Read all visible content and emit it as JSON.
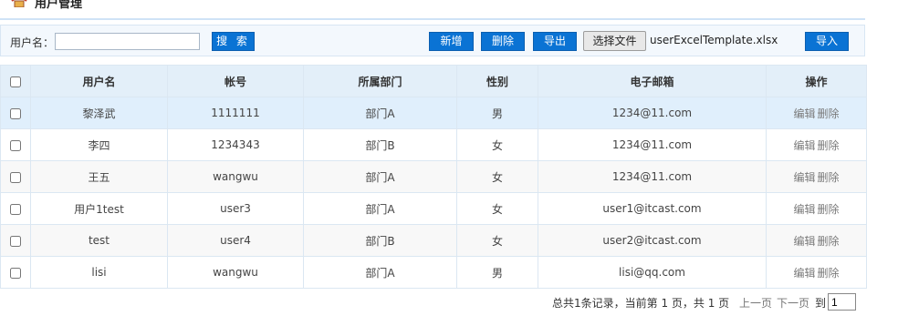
{
  "page": {
    "title": "用户管理",
    "icon": "home-icon"
  },
  "search": {
    "label": "用户名：",
    "value": "",
    "button_label": "搜 索"
  },
  "toolbar": {
    "add_label": "新增",
    "delete_label": "删除",
    "export_label": "导出",
    "choose_file_label": "选择文件",
    "file_name": "userExcelTemplate.xlsx",
    "import_label": "导入"
  },
  "table": {
    "columns": [
      "用户名",
      "帐号",
      "所属部门",
      "性别",
      "电子邮箱",
      "操作"
    ],
    "rows": [
      {
        "name": "黎泽武",
        "account": "1111111",
        "dept": "部门A",
        "gender": "男",
        "email": "1234@11.com",
        "edit": "编辑",
        "delete": "删除"
      },
      {
        "name": "李四",
        "account": "1234343",
        "dept": "部门B",
        "gender": "女",
        "email": "1234@11.com",
        "edit": "编辑",
        "delete": "删除"
      },
      {
        "name": "王五",
        "account": "wangwu",
        "dept": "部门A",
        "gender": "女",
        "email": "1234@11.com",
        "edit": "编辑",
        "delete": "删除"
      },
      {
        "name": "用户1test",
        "account": "user3",
        "dept": "部门A",
        "gender": "女",
        "email": "user1@itcast.com",
        "edit": "编辑",
        "delete": "删除"
      },
      {
        "name": "test",
        "account": "user4",
        "dept": "部门B",
        "gender": "女",
        "email": "user2@itcast.com",
        "edit": "编辑",
        "delete": "删除"
      },
      {
        "name": "lisi",
        "account": "wangwu",
        "dept": "部门A",
        "gender": "男",
        "email": "lisi@qq.com",
        "edit": "编辑",
        "delete": "删除"
      }
    ]
  },
  "pager": {
    "info": "总共1条记录，当前第 1 页，共 1 页",
    "prev": "上一页",
    "next": "下一页",
    "goto": "到",
    "page_value": "1"
  },
  "colors": {
    "accent": "#0a73d4",
    "header_bg": "#e3eff9",
    "selected_row": "#e0effc"
  }
}
